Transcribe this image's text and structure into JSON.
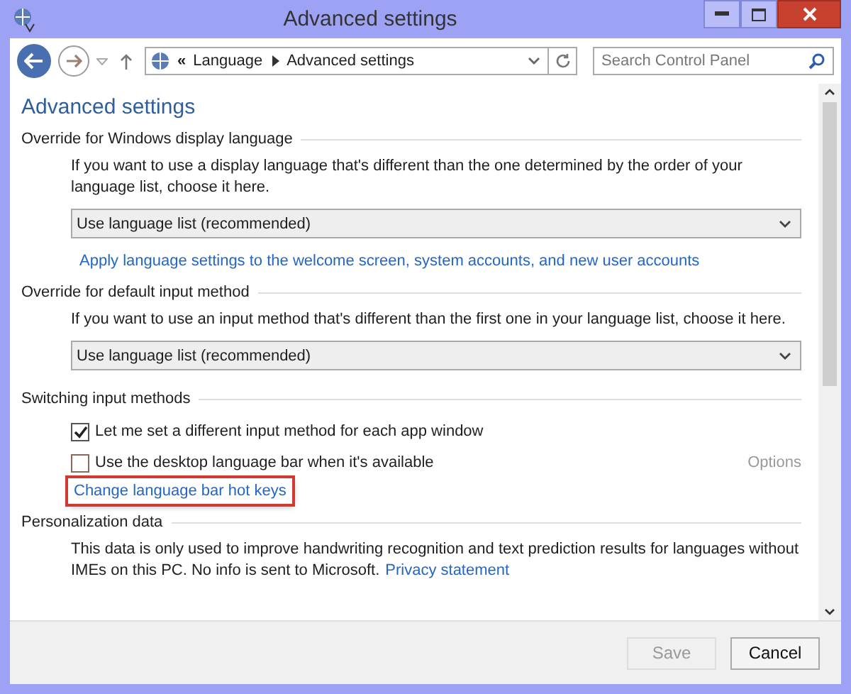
{
  "window": {
    "title": "Advanced settings"
  },
  "nav": {
    "overflow": "«",
    "breadcrumb": [
      "Language",
      "Advanced settings"
    ],
    "search": {
      "placeholder": "Search Control Panel"
    }
  },
  "heading": "Advanced settings",
  "sections": [
    {
      "title": "Override for Windows display language",
      "description": "If you want to use a display language that's different than the one determined by the order of your language list, choose it here.",
      "dropdown": {
        "value": "Use language list (recommended)"
      },
      "link": {
        "label": "Apply language settings to the welcome screen, system accounts, and new user accounts",
        "highlighted": false
      }
    },
    {
      "title": "Override for default input method",
      "description": "If you want to use an input method that's different than the first one in your language list, choose it here.",
      "dropdown": {
        "value": "Use language list (recommended)"
      }
    },
    {
      "title": "Switching input methods",
      "options": [
        {
          "label": "Let me set a different input method for each app window",
          "checked": true
        },
        {
          "label": "Use the desktop language bar when it's available",
          "checked": false,
          "side_link": {
            "label": "Options",
            "disabled": true
          }
        }
      ],
      "link": {
        "label": "Change language bar hot keys",
        "highlighted": true
      }
    },
    {
      "title": "Personalization data",
      "description": "This data is only used to improve handwriting recognition and text prediction results for languages without IMEs on this PC. No info is sent to Microsoft.",
      "inline_link": "Privacy statement"
    }
  ],
  "buttons": [
    {
      "label": "Save",
      "disabled": true
    },
    {
      "label": "Cancel",
      "disabled": false
    }
  ]
}
